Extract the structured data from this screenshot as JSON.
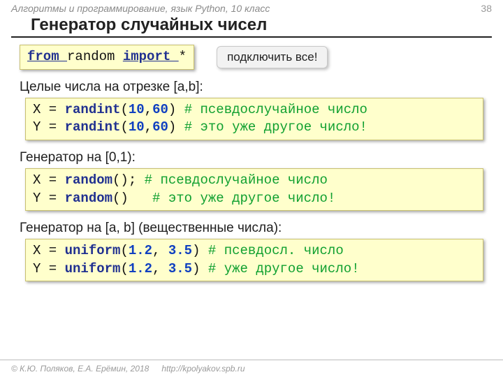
{
  "header": {
    "course": "Алгоритмы и программирование, язык Python, 10 класс",
    "page": "38"
  },
  "title": "Генератор случайных чисел",
  "import_line": {
    "t1": "from ",
    "t2": "random ",
    "t3": "import ",
    "t4": "*"
  },
  "callout": "подключить все!",
  "section1": {
    "label": "Целые числа на отрезке [a,b]:",
    "l1a": "X = ",
    "l1b": "randint",
    "l1c": "(",
    "l1d": "10",
    "l1e": ",",
    "l1f": "60",
    "l1g": ") ",
    "l1h": "# псевдослучайное число",
    "l2a": "Y = ",
    "l2b": "randint",
    "l2c": "(",
    "l2d": "10",
    "l2e": ",",
    "l2f": "60",
    "l2g": ") ",
    "l2h": "# это уже другое число!"
  },
  "section2": {
    "label": "Генератор на [0,1):",
    "l1a": "X = ",
    "l1b": "random",
    "l1c": "(); ",
    "l1d": "# псевдослучайное число",
    "l2a": "Y = ",
    "l2b": "random",
    "l2c": "()   ",
    "l2d": "# это уже другое число!"
  },
  "section3": {
    "label": "Генератор на [a, b] (вещественные числа):",
    "l1a": "X = ",
    "l1b": "uniform",
    "l1c": "(",
    "l1d": "1.2",
    "l1e": ", ",
    "l1f": "3.5",
    "l1g": ") ",
    "l1h": "# псевдосл. число",
    "l2a": "Y = ",
    "l2b": "uniform",
    "l2c": "(",
    "l2d": "1.2",
    "l2e": ", ",
    "l2f": "3.5",
    "l2g": ") ",
    "l2h": "# уже другое число!"
  },
  "footer": {
    "copyright": "© К.Ю. Поляков, Е.А. Ерёмин, 2018",
    "url": "http://kpolyakov.spb.ru"
  }
}
